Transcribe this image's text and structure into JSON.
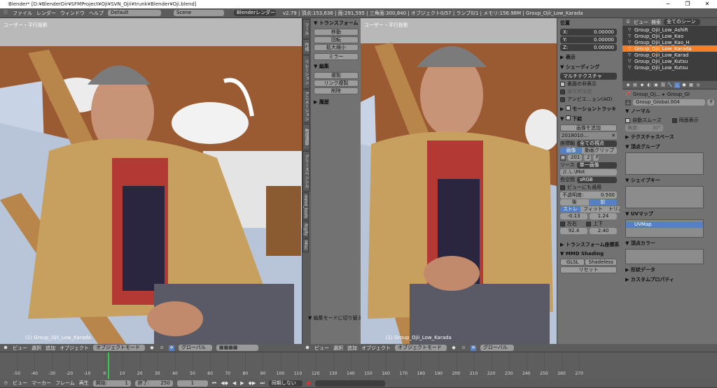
{
  "window": {
    "title": "Blender* [D:¥BlenderDir¥SFMProject¥Oji¥SVN_Ojii¥trunk¥Blender¥Oji.blend]",
    "min": "−",
    "max": "❐",
    "close": "✕"
  },
  "topbar": {
    "menus": [
      "ファイル",
      "レンダー",
      "ウィンドウ",
      "ヘルプ"
    ],
    "screen_layout": "Default",
    "scene": "Scene",
    "engine": "Blenderレンダー",
    "stats": "v2.79 | 頂点:153,636 | 面:291,595 | 三角面:300,840 | オブジェクト0/57 | ランプ0/1 | メモリ:156.98M | Group_Ojii_Low_Karada"
  },
  "viewport_left": {
    "label": "ユーザー・平行投影",
    "object_label": "(1) Group_Ojii_Low_Karada"
  },
  "viewport_right": {
    "label": "ユーザー・平行投影",
    "object_label": "(1) Group_Ojii_Low_Karada"
  },
  "tool_shelf": {
    "transform_title": "トランスフォーム",
    "transform_buttons": [
      "移動",
      "回転",
      "拡大縮小",
      "ミラー"
    ],
    "edit_title": "編集",
    "edit_buttons": [
      "複製",
      "リンク複製",
      "削除"
    ],
    "history_title": "履歴",
    "edit_mode_toggle": "編集モードに切り替え",
    "tabs": [
      "ツール",
      "作成",
      "リレーション",
      "アニメーション",
      "物理演算",
      "グリースペンシル",
      "mmd_tools",
      "Rigify",
      "Misc"
    ]
  },
  "viewport_header": {
    "menus": [
      "ビュー",
      "選択",
      "追加",
      "オブジェクト"
    ],
    "mode": "オブジェクトモード",
    "orientation": "グローバル"
  },
  "properties_n": {
    "position": "位置",
    "loc": [
      {
        "label": "X:",
        "value": "0.00000"
      },
      {
        "label": "Y:",
        "value": "0.00000"
      },
      {
        "label": "Z:",
        "value": "0.00000"
      }
    ],
    "display": "表示",
    "shading": "シェーディング",
    "shading_mode": "マルチテクスチャ",
    "opts": [
      {
        "label": "裏面の非表示",
        "on": true
      },
      {
        "label": "被写界深度",
        "on": false
      },
      {
        "label": "アンビエ…ョン(AO)",
        "on": false
      }
    ],
    "motion_tracking": "モーショントラッキ",
    "background": "下絵",
    "add_image": "画像を追加",
    "image_entry": "2018010…",
    "axis_label": "座標軸",
    "axis_value": "全ての視点",
    "src_image": "画像",
    "src_clip": "動画クリップ",
    "img_name": "201",
    "img_num": "2",
    "source_label": "ソース",
    "source_value": "単一画像",
    "path": "//..\\..\\Mot",
    "colorspace_label": "色空間",
    "colorspace_value": "sRGB",
    "view_as_render": "ビューにも適用",
    "opacity_label": "不透明度:",
    "opacity_value": "0.500",
    "back": "後",
    "front": "前",
    "stretch": "ストレ",
    "fit": "フィット",
    "crop": "トリム",
    "offx": "-0.13",
    "offy": "1.24",
    "flipx": "左右",
    "flipy": "上下",
    "rot": "92.4",
    "size": "2.40",
    "transform_orient": "トランスフォーム座標系",
    "mmd_shading": "MMD Shading",
    "glsl": "GLSL",
    "shadeless": "Shadeless",
    "reset": "リセット"
  },
  "outliner": {
    "header_view": "ビュー",
    "header_search": "検索",
    "header_scope": "全てのシーン",
    "rows": [
      {
        "name": "Group_Ojii_Low_AshiR",
        "sel": false
      },
      {
        "name": "Group_Ojii_Low_Kao",
        "sel": false
      },
      {
        "name": "Group_Ojii_Low_Kao_H",
        "sel": false
      },
      {
        "name": "Group_Ojii_Low_Karada",
        "sel": true
      },
      {
        "name": "Group_Ojii_Low_Karad",
        "sel": false
      },
      {
        "name": "Group_Ojii_Low_Kutsu",
        "sel": false
      },
      {
        "name": "Group_Ojii_Low_Kutsu",
        "sel": false
      }
    ]
  },
  "props": {
    "breadcrumb_obj": "Group_Oj…",
    "breadcrumb_data": "Group_Gl",
    "mesh_name": "Group_Global.004",
    "fake_user": "F",
    "normals_title": "ノーマル",
    "auto_smooth": "自動スムーズ",
    "double_sided": "両面表示",
    "angle_label": "角度:",
    "angle_value": "30°",
    "texture_space": "テクスチャスペース",
    "vertex_groups": "頂点グループ",
    "shape_keys": "シェイプキー",
    "uv_maps": "UVマップ",
    "uv_entry": "UVMap",
    "vertex_colors": "頂点カラー",
    "geometry_data": "形状データ",
    "custom_props": "カスタムプロパティ"
  },
  "timeline": {
    "ticks": [
      "-50",
      "-40",
      "-30",
      "-20",
      "-10",
      "0",
      "10",
      "20",
      "30",
      "40",
      "50",
      "60",
      "70",
      "80",
      "90",
      "100",
      "110",
      "120",
      "130",
      "140",
      "150",
      "160",
      "170",
      "180",
      "190",
      "200",
      "210",
      "220",
      "230",
      "240",
      "250",
      "260",
      "270"
    ],
    "menus": [
      "ビュー",
      "マーカー",
      "フレーム",
      "再生"
    ],
    "start_label": "開始:",
    "start_value": "1",
    "end_label": "終了:",
    "end_value": "250",
    "current": "1",
    "sync": "同期しない"
  },
  "colors": {
    "accent_blue": "#5680c2",
    "selection_orange": "#f27f2a",
    "current_frame": "#34c84a",
    "panel_bg": "#727272",
    "header_bg": "#5c5c5c"
  }
}
